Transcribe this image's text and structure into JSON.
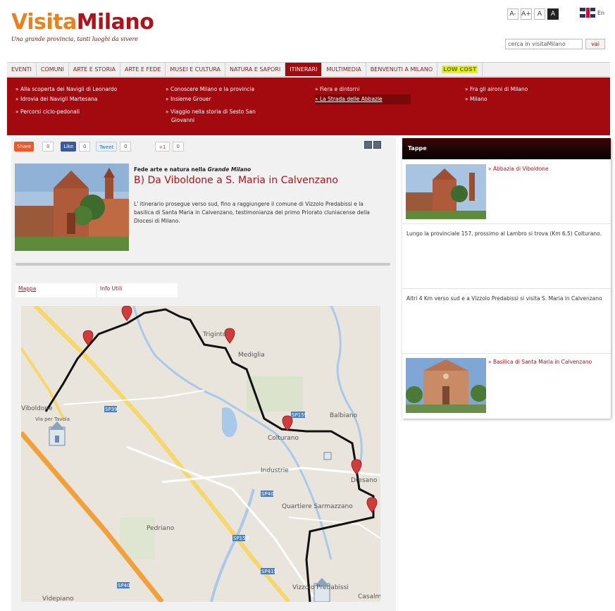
{
  "header": {
    "logo_part1": "Visita",
    "logo_part2": "Milano",
    "tagline": "Una grande provincia, tanti luoghi da vivere",
    "font_sizes": [
      "A-",
      "A+",
      "A",
      "A"
    ],
    "lang": "En",
    "search_placeholder": "cerca in visitaMilano",
    "search_button": "vai"
  },
  "nav": [
    {
      "label": "Eventi"
    },
    {
      "label": "Comuni"
    },
    {
      "label": "Arte e storia"
    },
    {
      "label": "Arte e fede"
    },
    {
      "label": "Musei e cultura"
    },
    {
      "label": "Natura e sapori"
    },
    {
      "label": "Itinerari",
      "active": true
    },
    {
      "label": "Multimedia"
    },
    {
      "label": "Benvenuti a Milano"
    },
    {
      "label": "Low cost"
    }
  ],
  "dropdown": {
    "col1": [
      "» Alla scoperta dei Navigli di Leonardo",
      "» Idrovia dei Navigli Martesana",
      "» Percorsi ciclo-pedonali"
    ],
    "col2": [
      "» Conoscere Milano e la provincia",
      "» Insieme Grouer",
      "» Viaggio nella storia di Sesto San",
      "Giovanni"
    ],
    "col3": [
      "» Fiera e dintorni",
      "» La Strada delle Abbazie"
    ],
    "col4": [
      "» Fra gli aironi di Milano",
      "» Milano"
    ]
  },
  "share": {
    "share_label": "Share",
    "share_count": "0",
    "like_label": "Like",
    "like_count": "0",
    "tweet_label": "Tweet",
    "tweet_count": "0",
    "gplus_label": "+1",
    "gplus_count": "0"
  },
  "article": {
    "kicker_prefix": "Fede arte e natura nella ",
    "kicker_em": "Grande Milano",
    "title": "B) Da Viboldone a S. Maria in Calvenzano",
    "intro": "L' itinerario prosegue verso sud, fino a raggiungere il comune di Vizzolo Predabissi e la basilica di Santa Maria in Calvenzano, testimonianza del primo Priorato cluniacense della Diocesi di Milano."
  },
  "tabs": [
    "Mappa",
    "Info Utili"
  ],
  "map": {
    "labels": [
      "Viboldone",
      "Triginto",
      "Mediglia",
      "Colturano",
      "Balbiano",
      "Industrie",
      "Quartiere Sarmazzano",
      "Pedriano",
      "Vizzolo Predabissi",
      "Dresano",
      "Casalmaiocco",
      "Videpiano",
      "Via per Tavola"
    ],
    "road_labels": [
      "SP39",
      "SP159",
      "SP40",
      "SP159",
      "SP415",
      "SP40"
    ]
  },
  "side": {
    "title": "Tappe",
    "items": [
      {
        "link": "» Abbazia di Viboldone"
      },
      {
        "text": "Lungo la provinciale 157, prossimo al Lambro si trova (Km 6.5) Colturano."
      },
      {
        "text": "Altri 4 Km verso sud e a Vizzolo Predabissi si visita S. Maria in Calvenzano"
      },
      {
        "link": "» Basilica di Santa Maria in Calvenzano"
      }
    ]
  },
  "colors": {
    "brand_red": "#b1121a",
    "brand_orange": "#e8821e",
    "nav_active": "#a20a10",
    "lowcost": "#e6f01a"
  }
}
